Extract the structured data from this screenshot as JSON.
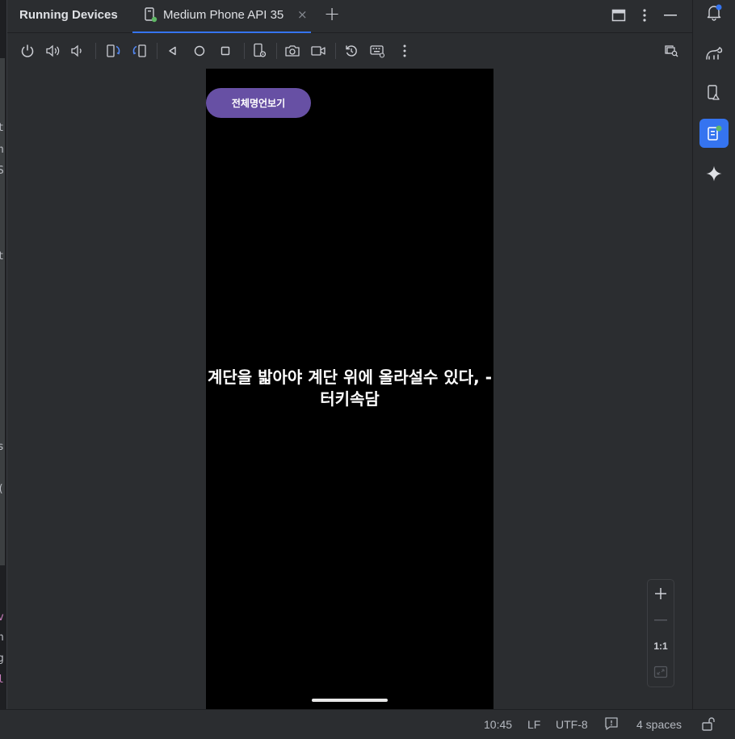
{
  "editor": {
    "edge_chars": [
      "t",
      "n",
      "S",
      "t",
      "s",
      "(",
      "v",
      "n",
      "g",
      "l"
    ]
  },
  "tool_window": {
    "title": "Running Devices",
    "tab": {
      "label": "Medium Phone API 35",
      "close": "×"
    },
    "add_tab": "+",
    "header_buttons": [
      "layout-icon",
      "more-vertical-icon",
      "minimize-icon"
    ],
    "toolbar_icons": [
      "power-icon",
      "volume-up-icon",
      "volume-down-icon",
      "rotate-left-icon",
      "rotate-right-icon",
      "back-icon",
      "home-icon",
      "overview-icon",
      "device-settings-icon",
      "screenshot-icon",
      "screen-record-icon",
      "reset-icon",
      "keyboard-icon",
      "more-vertical-icon",
      "window-search-icon"
    ]
  },
  "device": {
    "button_label": "전체명언보기",
    "quote": "계단을 밟아야 계단 위에 올라설수 있다, -터키속담",
    "accent_color": "#6750a4"
  },
  "zoom": {
    "zoom_in": "+",
    "zoom_out": "—",
    "actual_size": "1:1"
  },
  "right_strip": [
    "notifications-icon",
    "gradle-elephant-icon",
    "device-manager-icon",
    "running-devices-icon",
    "gemini-sparkle-icon"
  ],
  "status_bar": {
    "position": "10:45",
    "line_separator": "LF",
    "encoding": "UTF-8",
    "indent": "4 spaces"
  },
  "colors": {
    "background": "#2b2d30",
    "accent_blue": "#3574f0",
    "device_bg": "#000000"
  }
}
